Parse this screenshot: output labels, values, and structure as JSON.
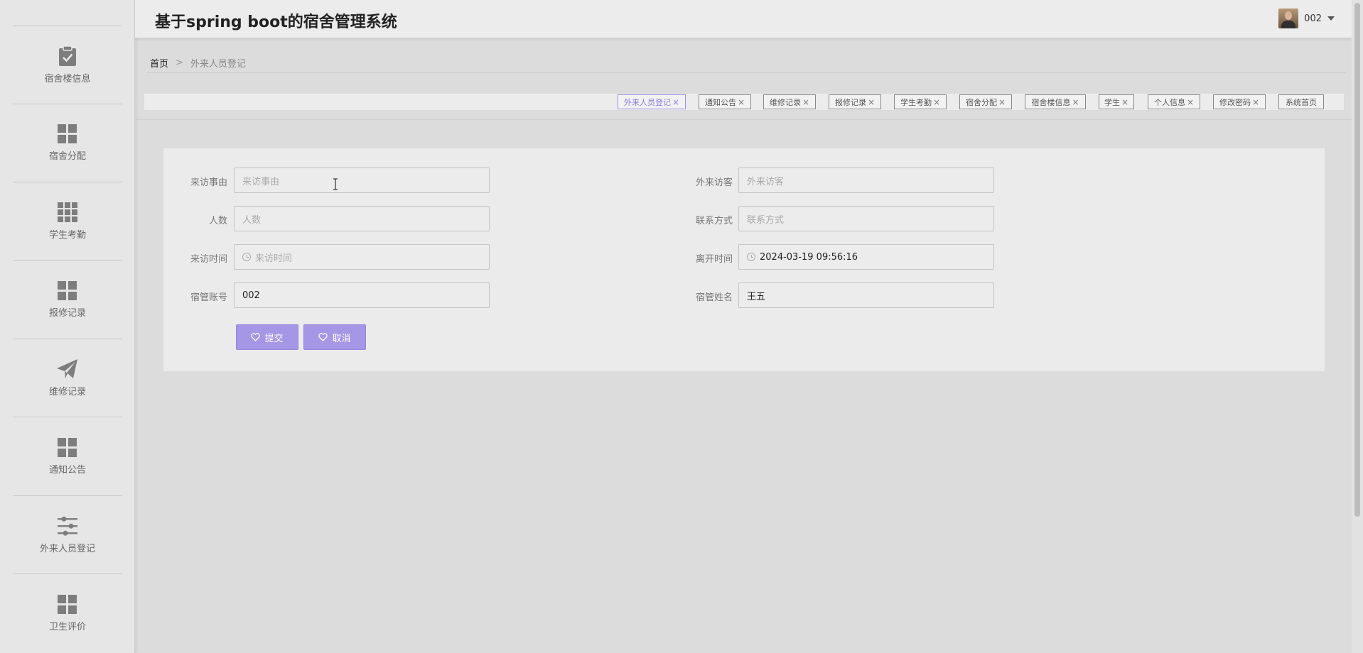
{
  "app": {
    "title": "基于spring boot的宿舍管理系统"
  },
  "user": {
    "name": "002"
  },
  "sidebar": {
    "items": [
      {
        "label": "宿舍楼信息",
        "icon": "clipboard-check-icon"
      },
      {
        "label": "宿舍分配",
        "icon": "grid-four-icon"
      },
      {
        "label": "学生考勤",
        "icon": "grid-nine-icon"
      },
      {
        "label": "报修记录",
        "icon": "grid-four-icon"
      },
      {
        "label": "维修记录",
        "icon": "paper-plane-icon"
      },
      {
        "label": "通知公告",
        "icon": "grid-four-icon"
      },
      {
        "label": "外来人员登记",
        "icon": "sliders-icon"
      },
      {
        "label": "卫生评价",
        "icon": "grid-four-icon"
      }
    ]
  },
  "breadcrumb": {
    "home": "首页",
    "separator": ">",
    "current": "外来人员登记"
  },
  "tabs": [
    {
      "label": "外来人员登记",
      "closable": true,
      "active": true
    },
    {
      "label": "通知公告",
      "closable": true
    },
    {
      "label": "维修记录",
      "closable": true
    },
    {
      "label": "报修记录",
      "closable": true
    },
    {
      "label": "学生考勤",
      "closable": true
    },
    {
      "label": "宿舍分配",
      "closable": true
    },
    {
      "label": "宿舍楼信息",
      "closable": true
    },
    {
      "label": "学生",
      "closable": true
    },
    {
      "label": "个人信息",
      "closable": true
    },
    {
      "label": "修改密码",
      "closable": true
    },
    {
      "label": "系统首页",
      "closable": false
    }
  ],
  "tab_close_glyph": "×",
  "form": {
    "reason": {
      "label": "来访事由",
      "value": "",
      "placeholder": "来访事由"
    },
    "visitor": {
      "label": "外来访客",
      "value": "",
      "placeholder": "外来访客"
    },
    "count": {
      "label": "人数",
      "value": "",
      "placeholder": "人数"
    },
    "contact": {
      "label": "联系方式",
      "value": "",
      "placeholder": "联系方式"
    },
    "visit_time": {
      "label": "来访时间",
      "value": "",
      "placeholder": "来访时间"
    },
    "leave_time": {
      "label": "离开时间",
      "value": "2024-03-19 09:56:16"
    },
    "manager_account": {
      "label": "宿管账号",
      "value": "002"
    },
    "manager_name": {
      "label": "宿管姓名",
      "value": "王五"
    },
    "submit_label": "提交",
    "cancel_label": "取消"
  },
  "colors": {
    "accent": "#a596e6",
    "active_tab": "#8d7be0",
    "sidebar_icon": "#7d7d7d"
  }
}
